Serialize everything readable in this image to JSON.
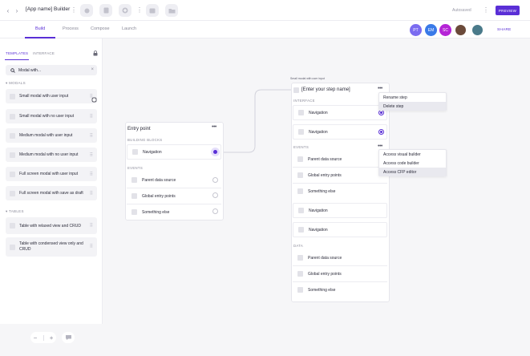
{
  "header": {
    "back_arrow": "‹",
    "forward_arrow": "›",
    "app_name": "[App name] Builder",
    "more": "⋮",
    "autosave": "Autosaved",
    "preview": "PREVIEW",
    "share": "SHARE",
    "tools": [
      "record-icon",
      "document-icon",
      "add-icon",
      "tools-more",
      "table-icon",
      "folder-icon"
    ]
  },
  "tabs": [
    {
      "label": "Build",
      "active": true
    },
    {
      "label": "Process",
      "active": false
    },
    {
      "label": "Compose",
      "active": false
    },
    {
      "label": "Launch",
      "active": false
    }
  ],
  "avatars": [
    {
      "initials": "PT",
      "color": "#7b6cf0"
    },
    {
      "initials": "EM",
      "color": "#3a7ae8"
    },
    {
      "initials": "SC",
      "color": "#b524d6"
    },
    {
      "initials": "",
      "color": "#6b4a3a"
    },
    {
      "initials": "",
      "color": "#4a7a8a"
    }
  ],
  "sidebar": {
    "tabs": [
      "TEMPLATES",
      "INTERFACE"
    ],
    "search_value": "Modal with...",
    "sections": [
      {
        "title": "MODALS",
        "items": [
          "Small modal with user input",
          "Small modal with no user input",
          "Medium modal with user input",
          "Medium modal with no user input",
          "Full screen modal with user input",
          "Full screen modal with save as draft"
        ]
      },
      {
        "title": "TABLES",
        "items": [
          "Table with relaxed view and CRUD",
          "Table with condensed view only and CRUD"
        ]
      }
    ]
  },
  "entry_card": {
    "title": "Entry point",
    "group1": "BUILDING BLOCKS",
    "block_label": "Navigation",
    "group2": "EVENTS",
    "events": [
      "Parent data source",
      "Global entry points",
      "Something else"
    ]
  },
  "step_card": {
    "small_label": "Small modal with user input",
    "title": "[Enter your step name]",
    "interface_label": "INTERFACE",
    "interface_rows": [
      "Navigation",
      "Navigation"
    ],
    "events_label": "EVENTS",
    "event_rows": [
      "Parent data source",
      "Global entry points",
      "Something else",
      "Navigation",
      "Navigation"
    ],
    "data_label": "DATA",
    "data_rows": [
      "Parent data source",
      "Global entry points",
      "Something else"
    ]
  },
  "step_menu": [
    "Rename step",
    "Delete step"
  ],
  "events_menu": [
    "Access visual builder",
    "Access code builder",
    "Access CFP editor"
  ],
  "zoom": {
    "minus": "−",
    "plus": "+"
  },
  "colors": {
    "accent": "#5a2fd6",
    "canvas_bg": "#f6f6f8"
  }
}
